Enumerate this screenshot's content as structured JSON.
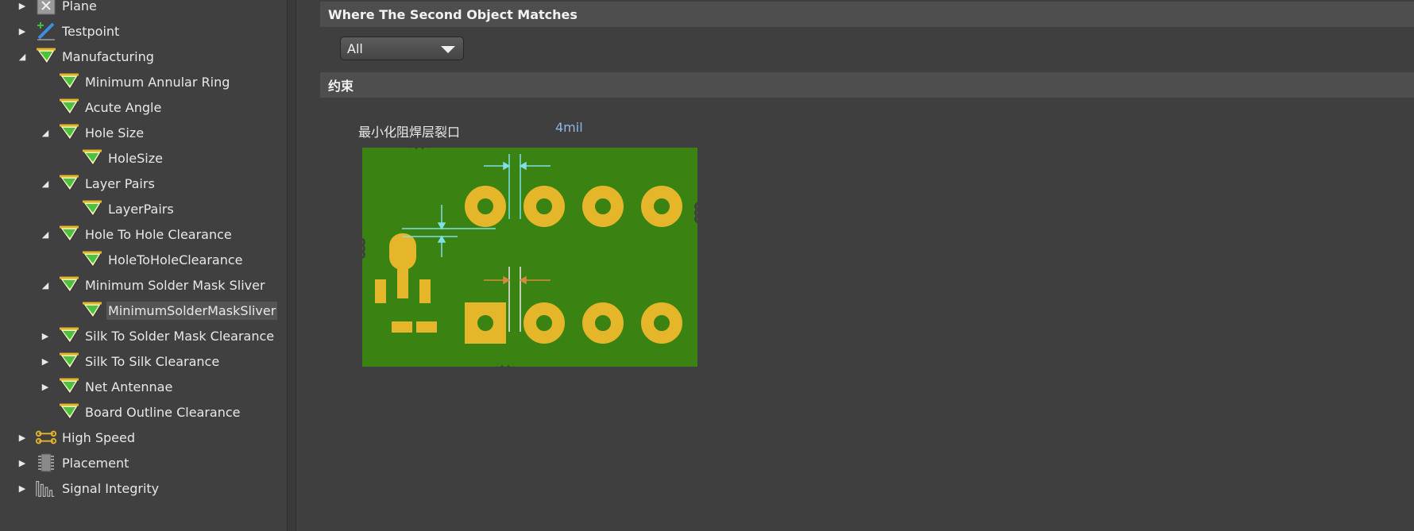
{
  "tree": {
    "items": [
      {
        "label": "Plane",
        "level": 0,
        "expander": "collapsed",
        "icon": "plane-rule-icon",
        "selected": false
      },
      {
        "label": "Testpoint",
        "level": 0,
        "expander": "collapsed",
        "icon": "testpoint-rule-icon",
        "selected": false
      },
      {
        "label": "Manufacturing",
        "level": 0,
        "expander": "expanded",
        "icon": "rule-funnel-icon",
        "selected": false
      },
      {
        "label": "Minimum Annular Ring",
        "level": 1,
        "expander": "none",
        "icon": "rule-funnel-icon",
        "selected": false
      },
      {
        "label": "Acute Angle",
        "level": 1,
        "expander": "none",
        "icon": "rule-funnel-icon",
        "selected": false
      },
      {
        "label": "Hole Size",
        "level": 1,
        "expander": "expanded",
        "icon": "rule-funnel-icon",
        "selected": false
      },
      {
        "label": "HoleSize",
        "level": 2,
        "expander": "none",
        "icon": "rule-funnel-icon",
        "selected": false
      },
      {
        "label": "Layer Pairs",
        "level": 1,
        "expander": "expanded",
        "icon": "rule-funnel-icon",
        "selected": false
      },
      {
        "label": "LayerPairs",
        "level": 2,
        "expander": "none",
        "icon": "rule-funnel-icon",
        "selected": false
      },
      {
        "label": "Hole To Hole Clearance",
        "level": 1,
        "expander": "expanded",
        "icon": "rule-funnel-icon",
        "selected": false
      },
      {
        "label": "HoleToHoleClearance",
        "level": 2,
        "expander": "none",
        "icon": "rule-funnel-icon",
        "selected": false
      },
      {
        "label": "Minimum Solder Mask Sliver",
        "level": 1,
        "expander": "expanded",
        "icon": "rule-funnel-icon",
        "selected": false
      },
      {
        "label": "MinimumSolderMaskSliver",
        "level": 2,
        "expander": "none",
        "icon": "rule-funnel-icon",
        "selected": true
      },
      {
        "label": "Silk To Solder Mask Clearance",
        "level": 1,
        "expander": "collapsed",
        "icon": "rule-funnel-icon",
        "selected": false
      },
      {
        "label": "Silk To Silk Clearance",
        "level": 1,
        "expander": "collapsed",
        "icon": "rule-funnel-icon",
        "selected": false
      },
      {
        "label": "Net Antennae",
        "level": 1,
        "expander": "collapsed",
        "icon": "rule-funnel-icon",
        "selected": false
      },
      {
        "label": "Board Outline Clearance",
        "level": 1,
        "expander": "none",
        "icon": "rule-funnel-icon",
        "selected": false
      },
      {
        "label": "High Speed",
        "level": 0,
        "expander": "collapsed",
        "icon": "high-speed-rule-icon",
        "selected": false
      },
      {
        "label": "Placement",
        "level": 0,
        "expander": "collapsed",
        "icon": "placement-rule-icon",
        "selected": false
      },
      {
        "label": "Signal Integrity",
        "level": 0,
        "expander": "collapsed",
        "icon": "signal-integrity-rule-icon",
        "selected": false
      }
    ]
  },
  "main": {
    "second_object_header": "Where The Second Object Matches",
    "second_object_select": "All",
    "constraints_header": "约束",
    "constraint_label": "最小化阻焊层裂口",
    "constraint_value": "4mil"
  },
  "colors": {
    "board_green": "#3a8212",
    "pad_gold": "#e5b52a",
    "dimension_cyan": "#7fe0e6",
    "dimension_orange": "#d68a3c"
  }
}
